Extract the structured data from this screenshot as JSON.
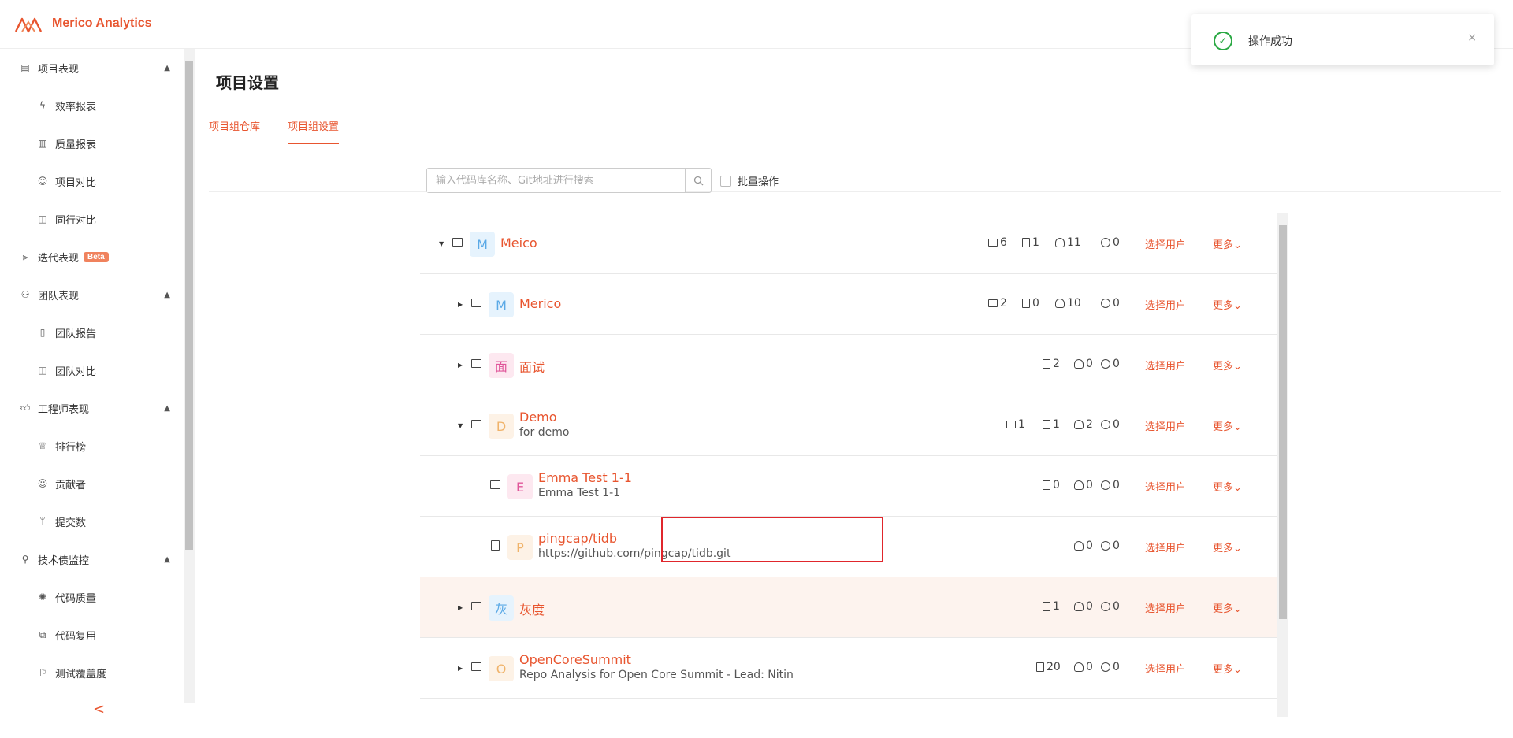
{
  "brand": {
    "name": "Merico Analytics"
  },
  "sidebar": {
    "items": [
      {
        "label": "项目表现",
        "type": "group",
        "icon": "dashboard-icon"
      },
      {
        "label": "效率报表",
        "type": "child",
        "icon": "lightning-icon"
      },
      {
        "label": "质量报表",
        "type": "child",
        "icon": "bar-chart-icon"
      },
      {
        "label": "项目对比",
        "type": "child",
        "icon": "smile-icon"
      },
      {
        "label": "同行对比",
        "type": "child",
        "icon": "compare-icon"
      },
      {
        "label": "迭代表现",
        "type": "group",
        "icon": "iteration-icon",
        "badge": "Beta"
      },
      {
        "label": "团队表现",
        "type": "group",
        "icon": "team-icon"
      },
      {
        "label": "团队报告",
        "type": "child",
        "icon": "report-icon"
      },
      {
        "label": "团队对比",
        "type": "child",
        "icon": "compare-icon"
      },
      {
        "label": "工程师表现",
        "type": "group",
        "icon": "thumb-up-icon"
      },
      {
        "label": "排行榜",
        "type": "child",
        "icon": "trophy-icon"
      },
      {
        "label": "贡献者",
        "type": "child",
        "icon": "smile-icon"
      },
      {
        "label": "提交数",
        "type": "child",
        "icon": "branch-icon"
      },
      {
        "label": "技术债监控",
        "type": "group",
        "icon": "search-icon"
      },
      {
        "label": "代码质量",
        "type": "child",
        "icon": "bug-icon"
      },
      {
        "label": "代码复用",
        "type": "child",
        "icon": "copy-icon"
      },
      {
        "label": "测试覆盖度",
        "type": "child",
        "icon": "flag-icon"
      }
    ],
    "collapse_label": "<"
  },
  "page": {
    "title": "项目设置",
    "tabs": [
      {
        "label": "项目组仓库"
      },
      {
        "label": "项目组设置"
      }
    ],
    "search_placeholder": "输入代码库名称、Git地址进行搜索",
    "batch_label": "批量操作"
  },
  "tree": {
    "rows": [
      {
        "name": "Meico",
        "desc": "",
        "avatar": "M",
        "stats": [
          "6",
          "1",
          "11",
          "0"
        ],
        "select_users": "选择用户",
        "more": "更多"
      },
      {
        "name": "Merico",
        "desc": "",
        "avatar": "M",
        "stats": [
          "2",
          "0",
          "10",
          "0"
        ],
        "select_users": "选择用户",
        "more": "更多"
      },
      {
        "name": "面试",
        "desc": "",
        "avatar": "面",
        "stats": [
          "2",
          "0",
          "0"
        ],
        "select_users": "选择用户",
        "more": "更多"
      },
      {
        "name": "Demo",
        "desc": "for demo",
        "avatar": "D",
        "stats": [
          "1",
          "1",
          "2",
          "0"
        ],
        "select_users": "选择用户",
        "more": "更多"
      },
      {
        "name": "Emma Test 1-1",
        "desc": "Emma Test 1-1",
        "avatar": "E",
        "stats": [
          "0",
          "0",
          "0"
        ],
        "select_users": "选择用户",
        "more": "更多"
      },
      {
        "name": "pingcap/tidb",
        "desc": "https://github.com/pingcap/tidb.git",
        "avatar": "P",
        "stats": [
          "0",
          "0"
        ],
        "select_users": "选择用户",
        "more": "更多"
      },
      {
        "name": "灰度",
        "desc": "",
        "avatar": "灰",
        "stats": [
          "1",
          "0",
          "0"
        ],
        "select_users": "选择用户",
        "more": "更多"
      },
      {
        "name": "OpenCoreSummit",
        "desc": "Repo Analysis for Open Core Summit - Lead: Nitin",
        "avatar": "O",
        "stats": [
          "20",
          "0",
          "0"
        ],
        "select_users": "选择用户",
        "more": "更多"
      }
    ]
  },
  "toast": {
    "message": "操作成功",
    "status": "success",
    "close": "×"
  },
  "colors": {
    "accent": "#e8552f",
    "success": "#2aa843",
    "highlight_row": "#fdf3ee",
    "selection": "#e0262c"
  }
}
